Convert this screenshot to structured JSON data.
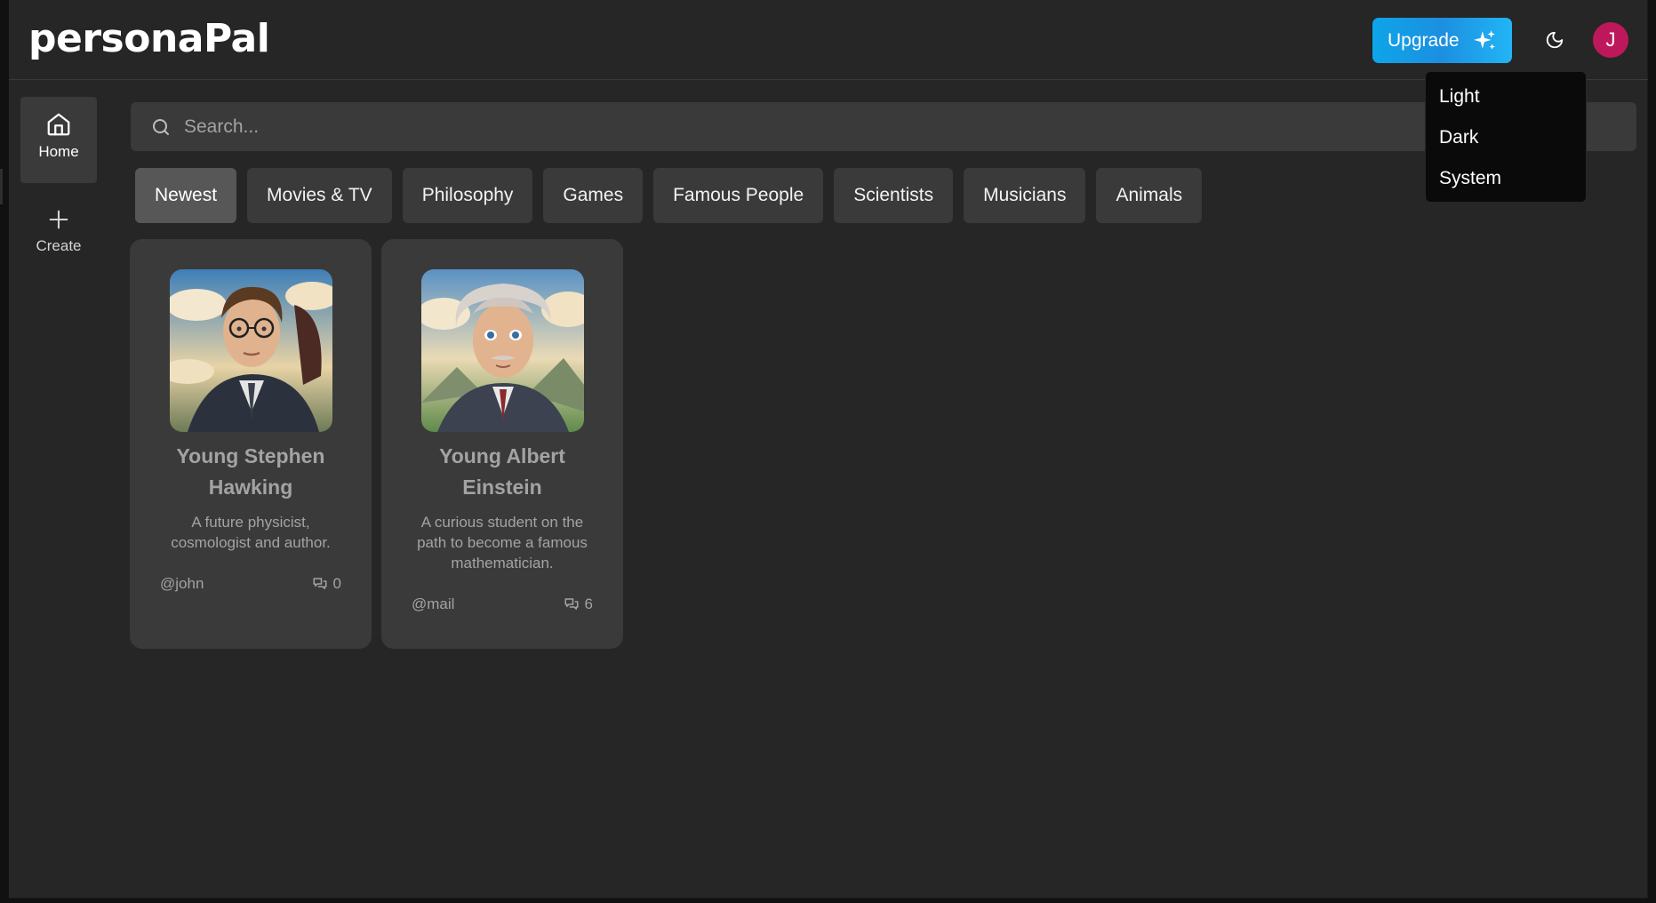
{
  "header": {
    "logo": "personaPal",
    "upgrade_label": "Upgrade",
    "theme_icon": "moon-icon",
    "avatar_initial": "J",
    "avatar_color": "#be185d",
    "accent": "#0ea5e9"
  },
  "sidebar": {
    "items": [
      {
        "label": "Home",
        "icon": "home-icon",
        "active": true
      },
      {
        "label": "Create",
        "icon": "plus-icon",
        "active": false
      }
    ]
  },
  "search": {
    "placeholder": "Search..."
  },
  "categories": [
    {
      "label": "Newest",
      "active": true
    },
    {
      "label": "Movies & TV"
    },
    {
      "label": "Philosophy"
    },
    {
      "label": "Games"
    },
    {
      "label": "Famous People"
    },
    {
      "label": "Scientists"
    },
    {
      "label": "Musicians"
    },
    {
      "label": "Animals"
    }
  ],
  "cards": [
    {
      "name": "Young Stephen Hawking",
      "description": "A future physicist, cosmologist and author.",
      "author": "@john",
      "count": "0"
    },
    {
      "name": "Young Albert Einstein",
      "description": "A curious student on the path to become a famous mathematician.",
      "author": "@mail",
      "count": "6"
    }
  ],
  "theme_menu": {
    "items": [
      "Light",
      "Dark",
      "System"
    ]
  }
}
